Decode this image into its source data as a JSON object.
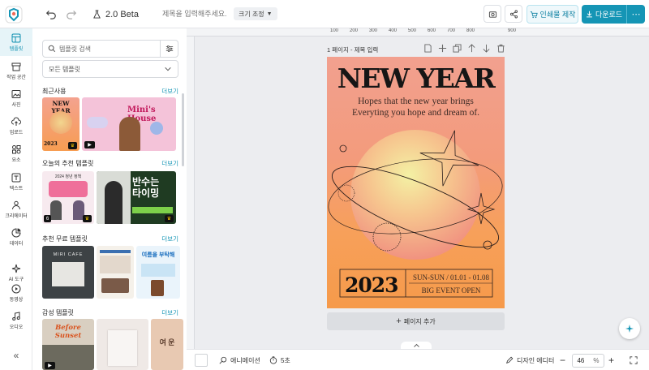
{
  "topbar": {
    "version_label": "2.0 Beta",
    "title_placeholder": "제목을 입력해주세요.",
    "resize_label": "크기 조정",
    "print_label": "인쇄물 제작",
    "download_label": "다운로드"
  },
  "rail": {
    "items": [
      {
        "label": "템플릿",
        "icon": "template-icon"
      },
      {
        "label": "작업 공간",
        "icon": "workspace-icon"
      },
      {
        "label": "사진",
        "icon": "photo-icon"
      },
      {
        "label": "업로드",
        "icon": "upload-icon"
      },
      {
        "label": "요소",
        "icon": "elements-icon"
      },
      {
        "label": "텍스트",
        "icon": "text-icon"
      },
      {
        "label": "크리에이터",
        "icon": "creator-icon"
      },
      {
        "label": "데이터",
        "icon": "data-icon"
      },
      {
        "label": "AI 도구",
        "icon": "ai-tools-icon"
      },
      {
        "label": "동영상",
        "icon": "video-icon"
      },
      {
        "label": "오디오",
        "icon": "audio-icon"
      }
    ]
  },
  "panel": {
    "search_placeholder": "템플릿 검색",
    "dropdown_value": "모든 템플릿",
    "more_label": "더보기",
    "sections": [
      {
        "title": "최근사용"
      },
      {
        "title": "오늘의 추천 템플릿"
      },
      {
        "title": "추천 무료 템플릿"
      },
      {
        "title": "감성 템플릿"
      }
    ],
    "thumb_texts": {
      "recent_1": "NEW YEAR",
      "recent_1_year": "2023",
      "recent_2": "Mini's House",
      "today_1_top": "2024 청년 정책",
      "today_2": "반수는\n타이밍",
      "today_1_badge": "6",
      "free_1": "MIRI CAFE",
      "free_3": "여름을 부탁해",
      "mood_1a": "Before",
      "mood_1b": "Sunset",
      "mood_3": "여 운"
    }
  },
  "canvas": {
    "ruler_marks": [
      "100",
      "200",
      "300",
      "400",
      "500",
      "600",
      "700",
      "800",
      "900"
    ],
    "page_label": "1 페이지 - 제목 입력",
    "add_page_label": "페이지 추가"
  },
  "poster": {
    "title": "NEW YEAR",
    "subtitle_1": "Hopes that the new year brings",
    "subtitle_2": "Everyting you hope and dream of.",
    "year": "2023",
    "date": "SUN-SUN / 01.01 - 01.08",
    "event": "BIG EVENT OPEN"
  },
  "bottombar": {
    "animation_label": "애니메이션",
    "duration_label": "5초",
    "design_editor_label": "디자인 에디터",
    "zoom_value": "46",
    "zoom_unit": "%"
  },
  "colors": {
    "accent": "#1595b5",
    "poster_top": "#f2a08f",
    "poster_bottom": "#f69a4a"
  }
}
